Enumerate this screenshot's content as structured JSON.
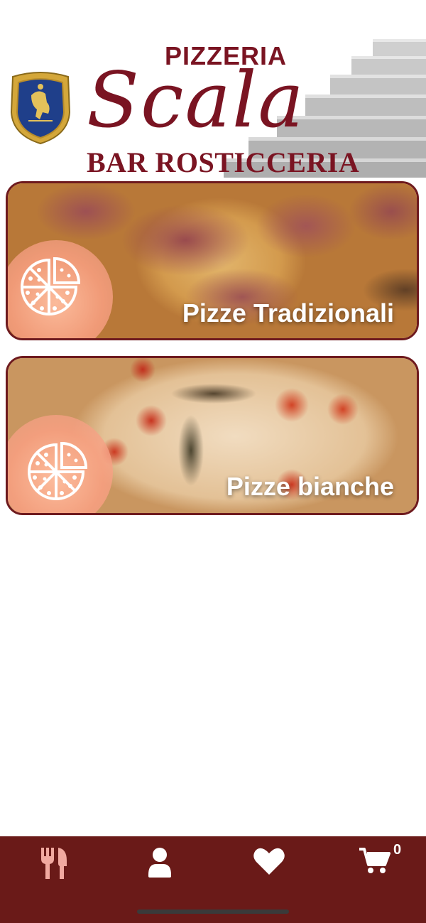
{
  "header": {
    "logo_line_top": "PIZZERIA",
    "logo_name": "Scala",
    "logo_line_bottom": "BAR ROSTICCERIA",
    "brand_color": "#7a1422"
  },
  "categories": [
    {
      "label": "Pizze Tradizionali",
      "icon": "pizza-icon"
    },
    {
      "label": "Pizze bianche",
      "icon": "pizza-icon"
    }
  ],
  "tabbar": {
    "background": "#6a1a18",
    "tabs": [
      {
        "name": "menu",
        "icon": "fork-knife-icon"
      },
      {
        "name": "profile",
        "icon": "user-icon"
      },
      {
        "name": "favorites",
        "icon": "heart-icon"
      },
      {
        "name": "cart",
        "icon": "cart-icon"
      }
    ],
    "cart_count": "0"
  }
}
